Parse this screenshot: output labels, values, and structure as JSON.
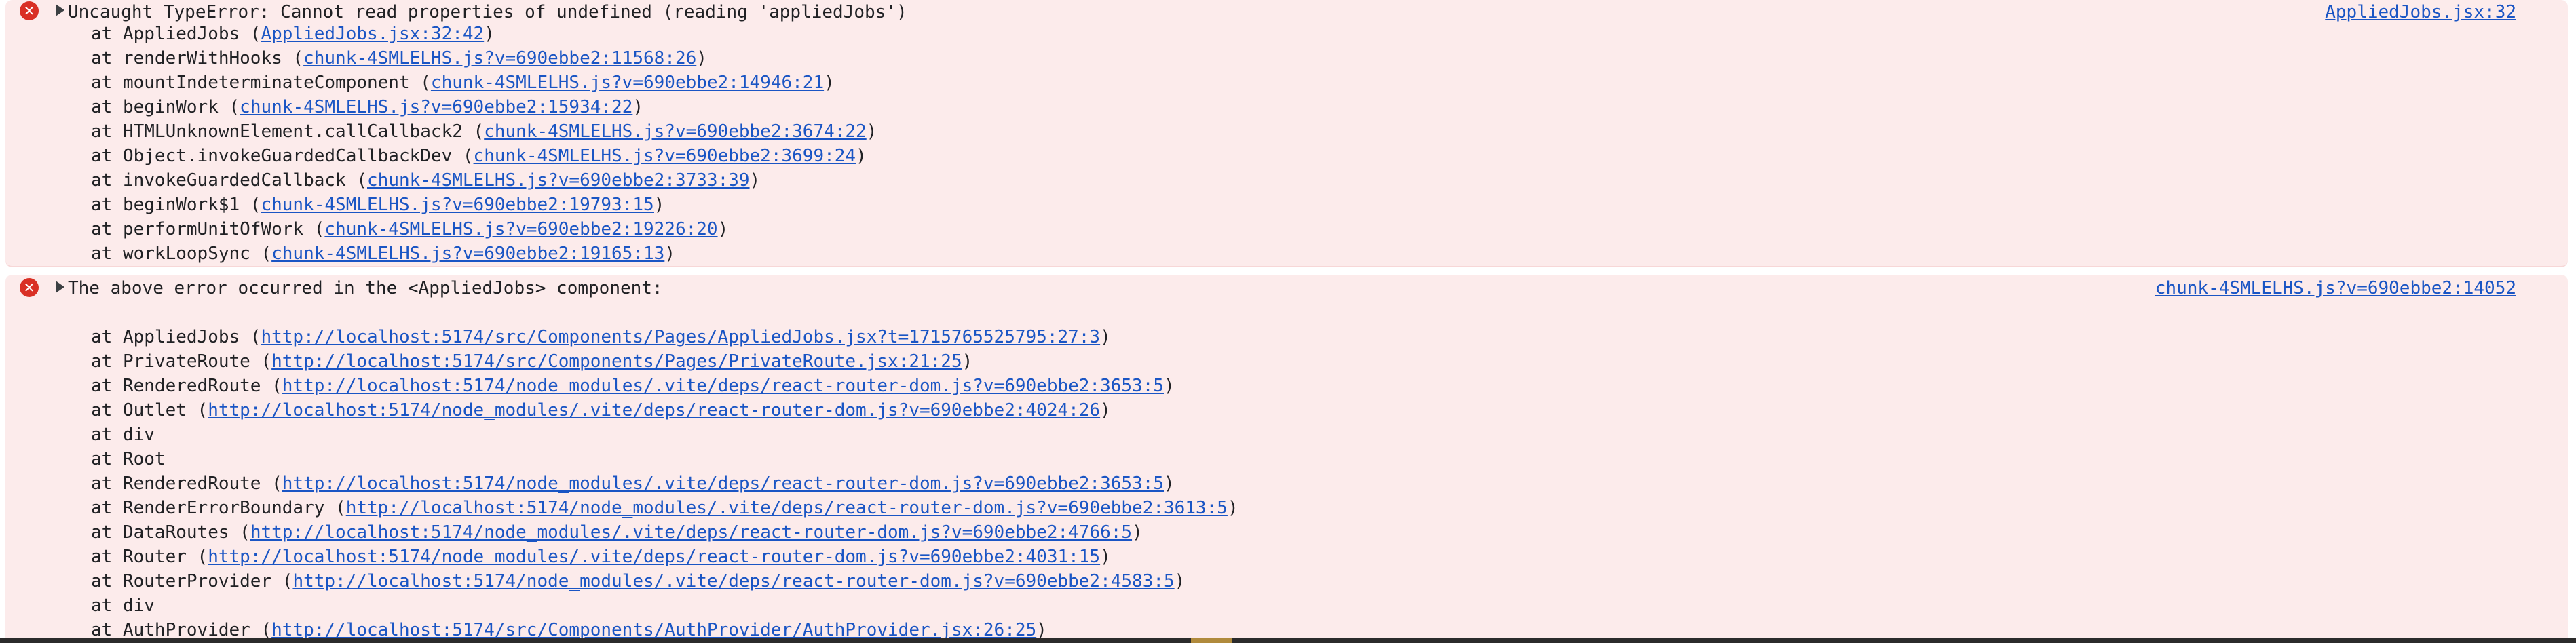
{
  "colors": {
    "error_bg": "#fcebeb",
    "error_icon": "#d93025",
    "link": "#1a55c4",
    "text": "#202124"
  },
  "error_icon_glyph": "✕",
  "messages": [
    {
      "headline": "Uncaught TypeError: Cannot read properties of undefined (reading 'appliedJobs')",
      "source": "AppliedJobs.jsx:32",
      "frames": [
        {
          "fn": "AppliedJobs",
          "loc": "AppliedJobs.jsx:32:42"
        },
        {
          "fn": "renderWithHooks",
          "loc": "chunk-4SMLELHS.js?v=690ebbe2:11568:26"
        },
        {
          "fn": "mountIndeterminateComponent",
          "loc": "chunk-4SMLELHS.js?v=690ebbe2:14946:21"
        },
        {
          "fn": "beginWork",
          "loc": "chunk-4SMLELHS.js?v=690ebbe2:15934:22"
        },
        {
          "fn": "HTMLUnknownElement.callCallback2",
          "loc": "chunk-4SMLELHS.js?v=690ebbe2:3674:22"
        },
        {
          "fn": "Object.invokeGuardedCallbackDev",
          "loc": "chunk-4SMLELHS.js?v=690ebbe2:3699:24"
        },
        {
          "fn": "invokeGuardedCallback",
          "loc": "chunk-4SMLELHS.js?v=690ebbe2:3733:39"
        },
        {
          "fn": "beginWork$1",
          "loc": "chunk-4SMLELHS.js?v=690ebbe2:19793:15"
        },
        {
          "fn": "performUnitOfWork",
          "loc": "chunk-4SMLELHS.js?v=690ebbe2:19226:20"
        },
        {
          "fn": "workLoopSync",
          "loc": "chunk-4SMLELHS.js?v=690ebbe2:19165:13"
        }
      ]
    },
    {
      "headline": "The above error occurred in the <AppliedJobs> component:",
      "source": "chunk-4SMLELHS.js?v=690ebbe2:14052",
      "frames": [
        {
          "fn": "AppliedJobs",
          "loc": "http://localhost:5174/src/Components/Pages/AppliedJobs.jsx?t=1715765525795:27:3"
        },
        {
          "fn": "PrivateRoute",
          "loc": "http://localhost:5174/src/Components/Pages/PrivateRoute.jsx:21:25"
        },
        {
          "fn": "RenderedRoute",
          "loc": "http://localhost:5174/node_modules/.vite/deps/react-router-dom.js?v=690ebbe2:3653:5"
        },
        {
          "fn": "Outlet",
          "loc": "http://localhost:5174/node_modules/.vite/deps/react-router-dom.js?v=690ebbe2:4024:26"
        },
        {
          "fn": "div",
          "loc": ""
        },
        {
          "fn": "Root",
          "loc": ""
        },
        {
          "fn": "RenderedRoute",
          "loc": "http://localhost:5174/node_modules/.vite/deps/react-router-dom.js?v=690ebbe2:3653:5"
        },
        {
          "fn": "RenderErrorBoundary",
          "loc": "http://localhost:5174/node_modules/.vite/deps/react-router-dom.js?v=690ebbe2:3613:5"
        },
        {
          "fn": "DataRoutes",
          "loc": "http://localhost:5174/node_modules/.vite/deps/react-router-dom.js?v=690ebbe2:4766:5"
        },
        {
          "fn": "Router",
          "loc": "http://localhost:5174/node_modules/.vite/deps/react-router-dom.js?v=690ebbe2:4031:15"
        },
        {
          "fn": "RouterProvider",
          "loc": "http://localhost:5174/node_modules/.vite/deps/react-router-dom.js?v=690ebbe2:4583:5"
        },
        {
          "fn": "div",
          "loc": ""
        },
        {
          "fn": "AuthProvider",
          "loc": "http://localhost:5174/src/Components/AuthProvider/AuthProvider.jsx:26:25"
        }
      ]
    }
  ]
}
